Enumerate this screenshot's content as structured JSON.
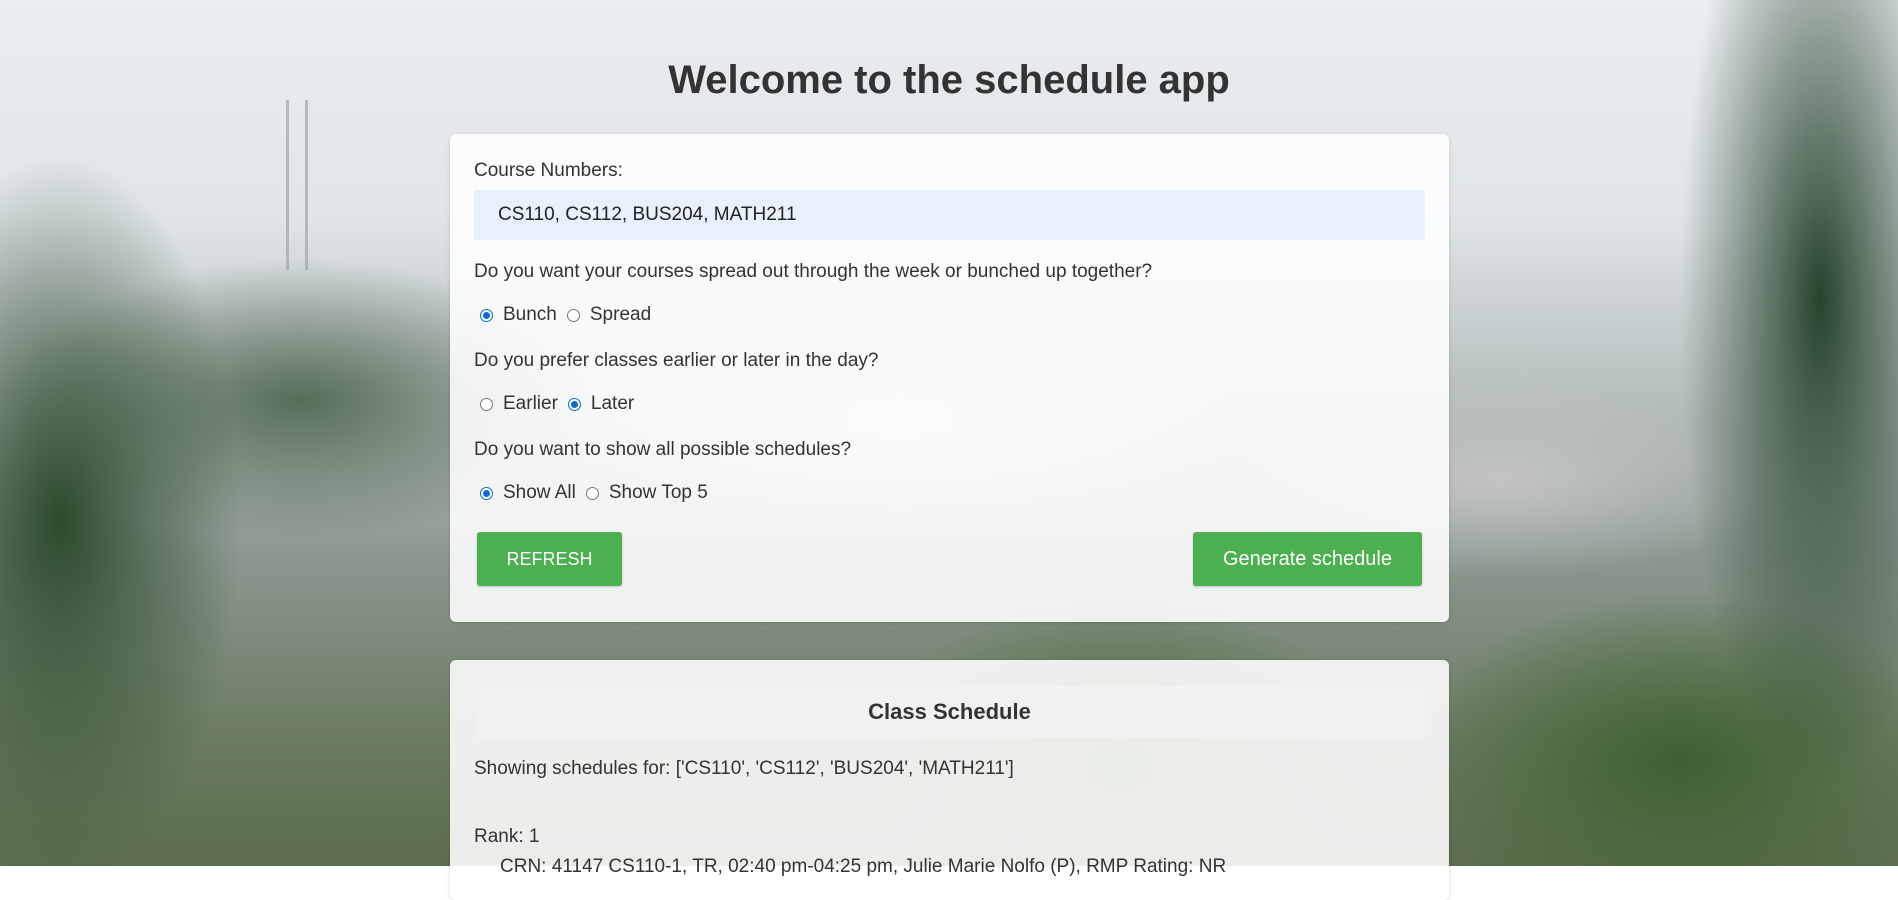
{
  "page": {
    "title": "Welcome to the schedule app"
  },
  "form": {
    "course_label": "Course Numbers:",
    "course_value": "CS110, CS112, BUS204, MATH211",
    "spread_question": "Do you want your courses spread out through the week or bunched up together?",
    "spread_options": [
      {
        "label": "Bunch",
        "checked": true
      },
      {
        "label": "Spread",
        "checked": false
      }
    ],
    "time_question": "Do you prefer classes earlier or later in the day?",
    "time_options": [
      {
        "label": "Earlier",
        "checked": false
      },
      {
        "label": "Later",
        "checked": true
      }
    ],
    "show_question": "Do you want to show all possible schedules?",
    "show_options": [
      {
        "label": "Show All",
        "checked": true
      },
      {
        "label": "Show Top 5",
        "checked": false
      }
    ],
    "refresh_label": "REFRESH",
    "generate_label": "Generate schedule"
  },
  "results": {
    "header": "Class Schedule",
    "showing": "Showing schedules for: ['CS110', 'CS112', 'BUS204', 'MATH211']",
    "rank": "Rank: 1",
    "first_entry": "CRN: 41147 CS110-1, TR, 02:40 pm-04:25 pm, Julie Marie Nolfo (P), RMP Rating: NR"
  },
  "colors": {
    "button_green": "#4caf50",
    "input_bg": "#e8f0fe",
    "radio_blue": "#0b68d6"
  }
}
